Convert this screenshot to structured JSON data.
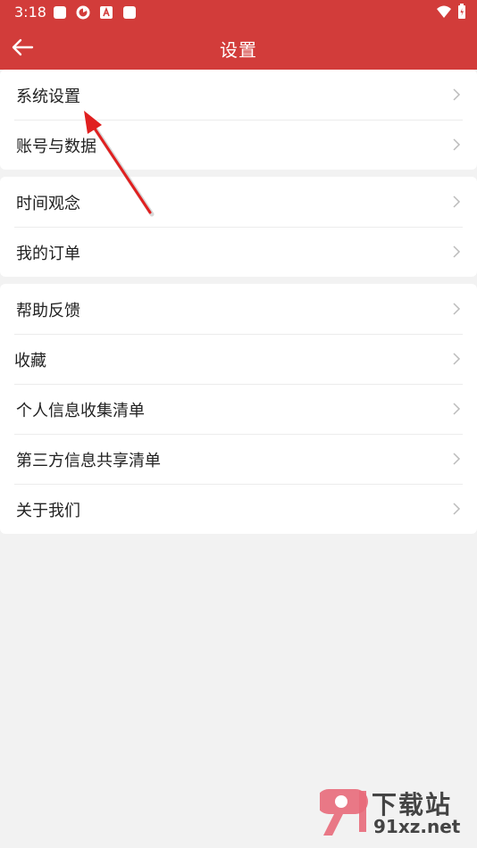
{
  "status_bar": {
    "time": "3:18"
  },
  "header": {
    "title": "设置"
  },
  "groups": [
    {
      "items": [
        {
          "label": "系统设置"
        },
        {
          "label": "账号与数据"
        }
      ]
    },
    {
      "items": [
        {
          "label": "时间观念"
        },
        {
          "label": "我的订单"
        }
      ]
    },
    {
      "items": [
        {
          "label": "帮助反馈"
        },
        {
          "label": "收藏"
        },
        {
          "label": "个人信息收集清单"
        },
        {
          "label": "第三方信息共享清单"
        },
        {
          "label": "关于我们"
        }
      ]
    }
  ],
  "watermark": {
    "title": "下载站",
    "site": "91xz.net"
  },
  "colors": {
    "brand_red": "#d23c3a",
    "background": "#f2f2f2"
  }
}
